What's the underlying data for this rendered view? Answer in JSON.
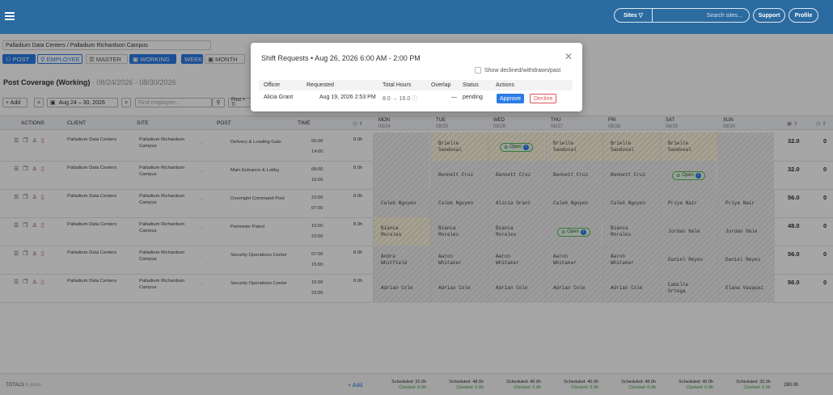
{
  "topbar": {
    "sites_label": "Sites ▽",
    "search_placeholder": "Search sites...",
    "support_label": "Support",
    "profile_label": "Profile"
  },
  "selector": {
    "value": "Palladium Data Centers / Palladium Richardson Campus"
  },
  "viewtabs": {
    "post": "POST",
    "employee": "EMPLOYEE",
    "master": "MASTER",
    "working": "WORKING",
    "week": "WEEK",
    "month": "MONTH"
  },
  "page": {
    "title": "Post Coverage (Working)",
    "range": "· 08/24/2026 - 08/30/2026"
  },
  "controls": {
    "add": "+ Add",
    "week": "Aug 24 – 30, 2026",
    "find_placeholder": "Find employee...",
    "post_filter": "Post + Ti"
  },
  "columns": {
    "actions": "ACTIONS",
    "client": "CLIENT",
    "site": "SITE",
    "post": "POST",
    "time": "TIME"
  },
  "days": [
    {
      "name": "MON",
      "date": "08/24"
    },
    {
      "name": "TUE",
      "date": "08/25"
    },
    {
      "name": "WED",
      "date": "08/26"
    },
    {
      "name": "THU",
      "date": "08/27"
    },
    {
      "name": "FRI",
      "date": "08/28"
    },
    {
      "name": "SAT",
      "date": "08/29"
    },
    {
      "name": "SUN",
      "date": "08/30"
    }
  ],
  "rows": [
    {
      "client": "Palladium Data Centers",
      "site": "Palladium Richardson Campus",
      "post": "Delivery & Loading Gate",
      "start": "06:00",
      "end": "14:00",
      "hours": "8.0h",
      "cells": [
        "",
        "Brielle Sandoval",
        "Open",
        "Brielle Sandoval",
        "Brielle Sandoval",
        "Brielle Sandoval",
        ""
      ],
      "total": "32.0",
      "other": "0"
    },
    {
      "client": "Palladium Data Centers",
      "site": "Palladium Richardson Campus",
      "post": "Main Entrance & Lobby",
      "start": "08:00",
      "end": "16:00",
      "hours": "8.0h",
      "cells": [
        "",
        "Bennett Cruz",
        "Bennett Cruz",
        "Bennett Cruz",
        "Bennett Cruz",
        "Open",
        ""
      ],
      "total": "32.0",
      "other": "0"
    },
    {
      "client": "Palladium Data Centers",
      "site": "Palladium Richardson Campus",
      "post": "Overnight Command Post",
      "start": "23:00",
      "end": "07:00",
      "hours": "8.0h",
      "cells": [
        "Caleb Nguyen",
        "Caleb Nguyen",
        "Alicia Grant",
        "Caleb Nguyen",
        "Caleb Nguyen",
        "Priya Nair",
        "Priya Nair"
      ],
      "total": "56.0",
      "other": "0"
    },
    {
      "client": "Palladium Data Centers",
      "site": "Palladium Richardson Campus",
      "post": "Perimeter Patrol",
      "start": "15:00",
      "end": "23:00",
      "hours": "8.0h",
      "cells": [
        "Bianca Morales",
        "Bianca Morales",
        "Bianca Morales",
        "Open",
        "Bianca Morales",
        "Jordan Hale",
        "Jordan Hale"
      ],
      "total": "48.0",
      "other": "0"
    },
    {
      "client": "Palladium Data Centers",
      "site": "Palladium Richardson Campus",
      "post": "Security Operations Center",
      "start": "07:00",
      "end": "15:00",
      "hours": "8.0h",
      "cells": [
        "Andre Whitfield",
        "Aaron Whitaker",
        "Aaron Whitaker",
        "Aaron Whitaker",
        "Aaron Whitaker",
        "Daniel Reyes",
        "Daniel Reyes"
      ],
      "total": "56.0",
      "other": "0"
    },
    {
      "client": "Palladium Data Centers",
      "site": "Palladium Richardson Campus",
      "post": "Security Operations Center",
      "start": "15:00",
      "end": "23:00",
      "hours": "8.0h",
      "cells": [
        "Adrian Cole",
        "Adrian Cole",
        "Adrian Cole",
        "Adrian Cole",
        "Adrian Cole",
        "Camille Ortega",
        "Elana Vasquez"
      ],
      "total": "56.0",
      "other": "0"
    }
  ],
  "footer": {
    "label": "TOTALS",
    "count": "6 posts",
    "add": "+ Add",
    "grand": "280.0h",
    "days": [
      {
        "sched": "Scheduled: 32.0h",
        "clock": "Clocked: 0.0h"
      },
      {
        "sched": "Scheduled: 48.0h",
        "clock": "Clocked: 0.0h"
      },
      {
        "sched": "Scheduled: 40.0h",
        "clock": "Clocked: 0.0h"
      },
      {
        "sched": "Scheduled: 40.0h",
        "clock": "Clocked: 0.0h"
      },
      {
        "sched": "Scheduled: 48.0h",
        "clock": "Clocked: 0.0h"
      },
      {
        "sched": "Scheduled: 40.0h",
        "clock": "Clocked: 0.0h"
      },
      {
        "sched": "Scheduled: 32.0h",
        "clock": "Clocked: 0.0h"
      }
    ]
  },
  "modal": {
    "title": "Shift Requests • Aug 26, 2026 6:00 AM - 2:00 PM",
    "show_past": "Show declined/withdrawn/past",
    "headers": {
      "officer": "Officer",
      "requested": "Requested",
      "total": "Total Hours",
      "overlap": "Overlap",
      "status": "Status",
      "actions": "Actions"
    },
    "row": {
      "officer": "Alicia Grant",
      "requested": "Aug 19, 2026 2:53 PM",
      "total": "8.0 → 16.0",
      "overlap": "—",
      "status": "pending",
      "approve": "Approve",
      "decline": "Decline"
    }
  },
  "colors": {
    "topbar": "#2c6ba0",
    "accent": "#2c7be5",
    "decline": "#d9534f",
    "open": "#5cb85c"
  }
}
